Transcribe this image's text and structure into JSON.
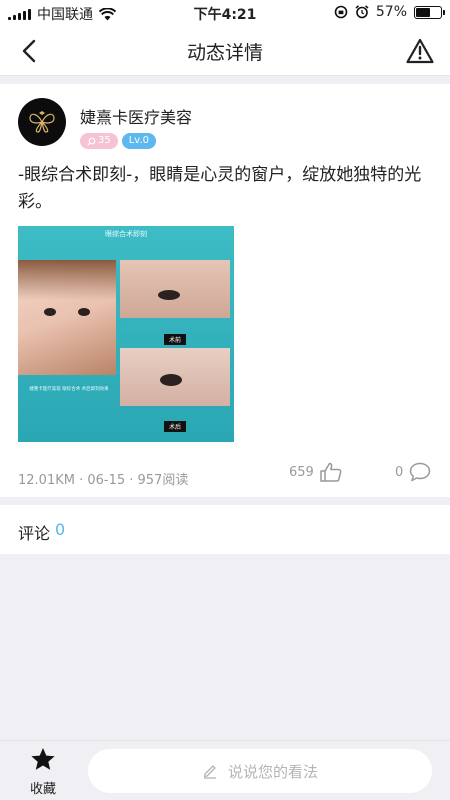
{
  "status_bar": {
    "carrier": "中国联通",
    "time": "下午4:21",
    "battery_percent": "57%",
    "battery_level": 0.57
  },
  "nav": {
    "title": "动态详情",
    "back_icon": "chevron-left-icon",
    "report_icon": "warning-triangle-icon"
  },
  "post": {
    "author": {
      "name": "婕熹卡医疗美容",
      "fans_badge": "35",
      "level_badge": "Lv.0"
    },
    "text": "-眼综合术即刻-，眼睛是心灵的窗户，绽放她独特的光彩。",
    "image": {
      "title": "眼综合术即刻",
      "tag_before": "术前",
      "tag_after": "术后",
      "caption": "婕熹卡医疗美容 眼综合术 术后即刻效果"
    },
    "meta": "12.01KM · 06-15 · 957阅读",
    "likes": "659",
    "comments": "0"
  },
  "comment_section": {
    "label": "评论",
    "count": "0"
  },
  "bottom_bar": {
    "favorite_label": "收藏",
    "input_placeholder": "说说您的看法"
  },
  "colors": {
    "accent_blue": "#58b7ea",
    "badge_pink": "#f6c3d4",
    "badge_blue": "#5cb8ee",
    "background": "#efeff4"
  }
}
